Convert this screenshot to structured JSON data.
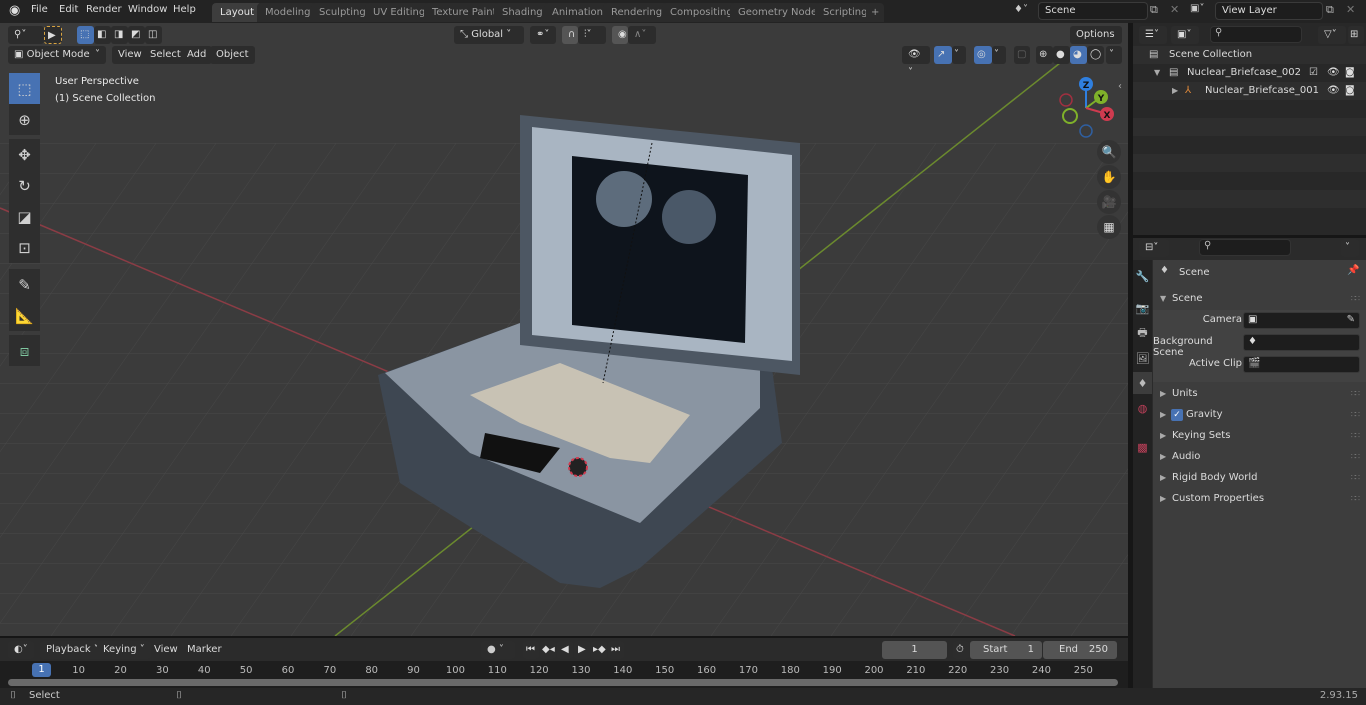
{
  "menu": {
    "items": [
      "File",
      "Edit",
      "Render",
      "Window",
      "Help"
    ]
  },
  "workspaces": {
    "tabs": [
      "Layout",
      "Modeling",
      "Sculpting",
      "UV Editing",
      "Texture Paint",
      "Shading",
      "Animation",
      "Rendering",
      "Compositing",
      "Geometry Nodes",
      "Scripting"
    ],
    "active": "Layout",
    "add_label": "+"
  },
  "scene_selector": {
    "value": "Scene"
  },
  "view_layer_selector": {
    "value": "View Layer"
  },
  "viewport": {
    "mode": "Object Mode",
    "menus": [
      "View",
      "Select",
      "Add",
      "Object"
    ],
    "orientation": "Global",
    "options_label": "Options",
    "overlay_text": {
      "line1": "User Perspective",
      "line2": "(1) Scene Collection"
    },
    "gizmo_axes": {
      "z": "Z",
      "y": "Y",
      "x": "X"
    },
    "axis_colors": {
      "x": "#cf3b4f",
      "y": "#7fb12a",
      "z": "#2f7fe0"
    },
    "tools": [
      "select-box",
      "cursor",
      "move",
      "rotate",
      "scale",
      "transform",
      "annotate",
      "measure",
      "add-cube"
    ]
  },
  "outliner": {
    "search_placeholder": "",
    "items": [
      {
        "label": "Scene Collection",
        "level": 0
      },
      {
        "label": "Nuclear_Briefcase_002",
        "level": 1,
        "checked": true
      },
      {
        "label": "Nuclear_Briefcase_001",
        "level": 2
      }
    ]
  },
  "properties": {
    "breadcrumb": "Scene",
    "search_placeholder": "",
    "scene_panel": {
      "title": "Scene",
      "fields": [
        {
          "label": "Camera",
          "value": ""
        },
        {
          "label": "Background Scene",
          "value": ""
        },
        {
          "label": "Active Clip",
          "value": ""
        }
      ]
    },
    "panels": [
      "Units",
      "Gravity",
      "Keying Sets",
      "Audio",
      "Rigid Body World",
      "Custom Properties"
    ],
    "gravity_enabled": true
  },
  "timeline": {
    "menus": [
      "Playback",
      "Keying",
      "View",
      "Marker"
    ],
    "current_frame": "1",
    "start_label": "Start",
    "start": "1",
    "end_label": "End",
    "end": "250",
    "ticks": [
      "10",
      "20",
      "30",
      "40",
      "50",
      "60",
      "70",
      "80",
      "90",
      "100",
      "110",
      "120",
      "130",
      "140",
      "150",
      "160",
      "170",
      "180",
      "190",
      "200",
      "210",
      "220",
      "230",
      "240",
      "250"
    ],
    "playhead": "1"
  },
  "status_bar": {
    "left_action": "Select",
    "version": "2.93.15"
  }
}
